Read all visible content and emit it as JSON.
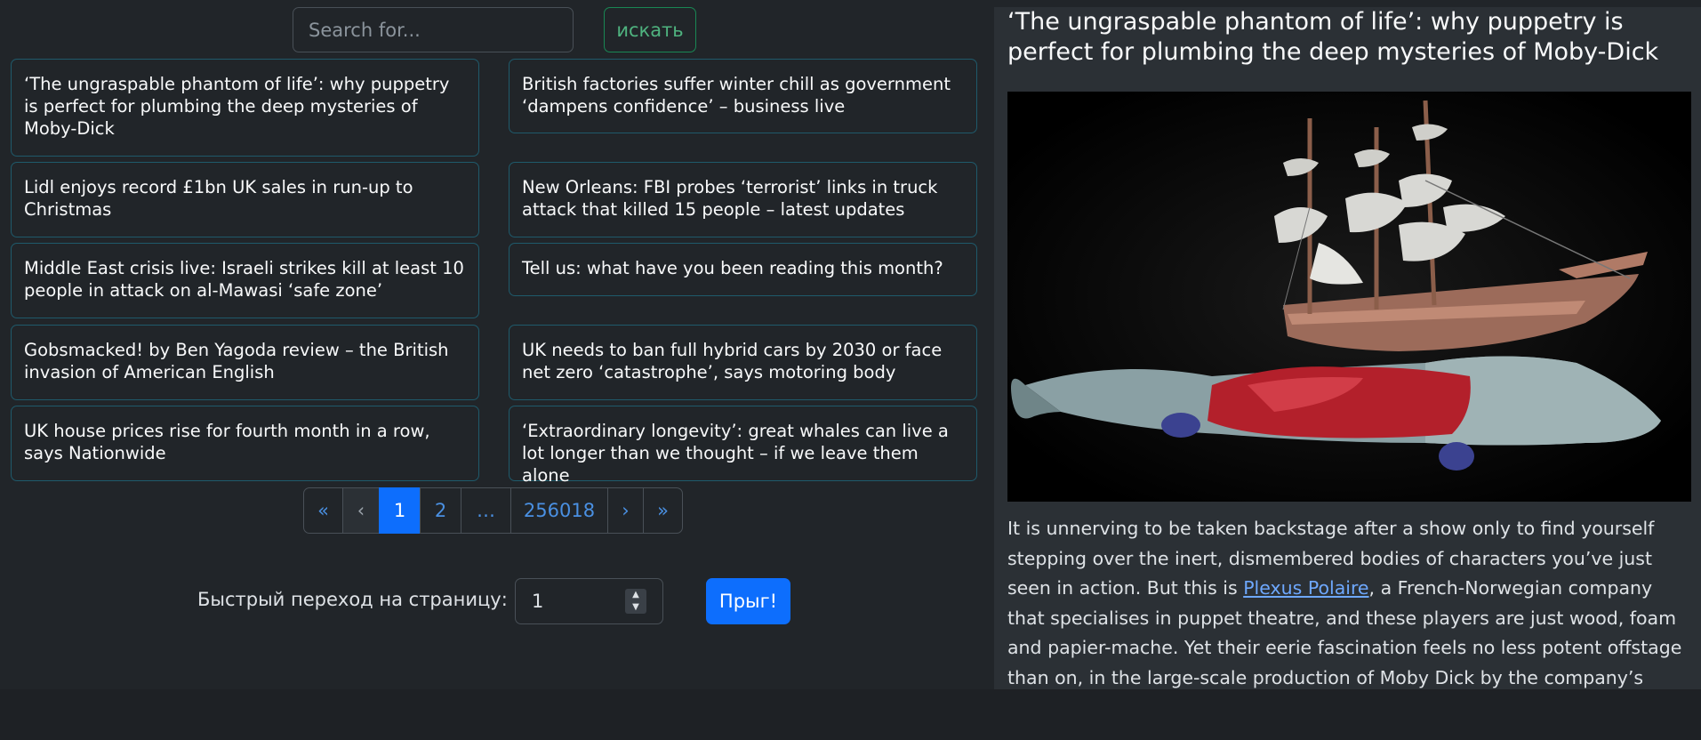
{
  "search": {
    "placeholder": "Search for...",
    "button_label": "искать"
  },
  "articles": [
    "‘The ungraspable phantom of life’: why puppetry is perfect for plumbing the deep mysteries of Moby-Dick",
    "British factories suffer winter chill as government ‘dampens confidence’ – business live",
    "Lidl enjoys record £1bn UK sales in run-up to Christmas",
    "New Orleans: FBI probes ‘terrorist’ links in truck attack that killed 15 people – latest updates",
    "Middle East crisis live: Israeli strikes kill at least 10 people in attack on al-Mawasi ‘safe zone’",
    "Tell us: what have you been reading this month?",
    "Gobsmacked! by Ben Yagoda review – the British invasion of American English",
    "UK needs to ban full hybrid cars by 2030 or face net zero ‘catastrophe’, says motoring body",
    "UK house prices rise for fourth month in a row, says Nationwide",
    "‘Extraordinary longevity’: great whales can live a lot longer than we thought – if we leave them alone"
  ],
  "pagination": {
    "first": "«",
    "prev": "‹",
    "pages": [
      "1",
      "2",
      "…",
      "256018"
    ],
    "active": "1",
    "next": "›",
    "last": "»"
  },
  "jump": {
    "label": "Быстрый переход на страницу:",
    "value": "1",
    "button_label": "Прыг!"
  },
  "article": {
    "title": "‘The ungraspable phantom of life’: why puppetry is perfect for plumbing the deep mysteries of Moby-Dick",
    "body_before_link": "It is unnerving to be taken backstage after a show only to find yourself stepping over the inert, dismembered bodies of characters you’ve just seen in action. But this is ",
    "link_text": "Plexus Polaire",
    "body_after_link": ", a French-Norwegian company that specialises in puppet theatre, and these players are just wood, foam and papier-mache. Yet their eerie fascination feels no less potent offstage than on, in the large-scale production of Moby Dick by the company’s founder and"
  },
  "colors": {
    "accent": "#0d6efd",
    "success": "#198754",
    "card_border": "#1f5a6b",
    "link": "#6ea8fe"
  }
}
